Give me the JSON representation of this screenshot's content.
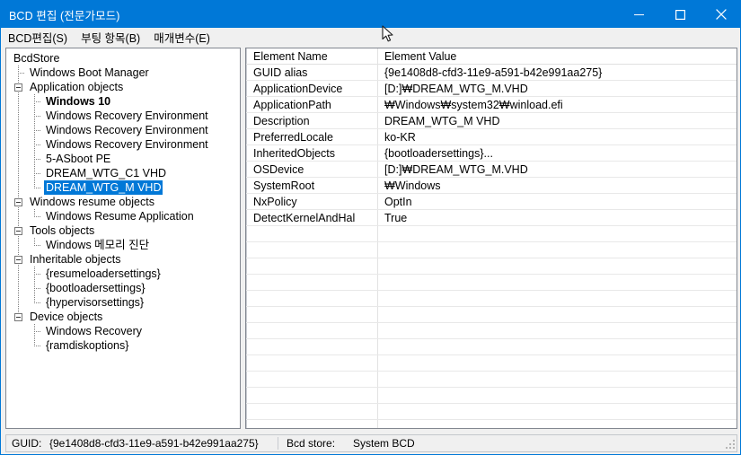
{
  "window": {
    "title": "BCD 편집 (전문가모드)",
    "accent_color": "#0078d7",
    "controls": {
      "minimize": "minimize-icon",
      "maximize": "maximize-icon",
      "close": "close-icon"
    }
  },
  "menubar": {
    "items": [
      {
        "label": "BCD편집(S)"
      },
      {
        "label": "부팅 항목(B)"
      },
      {
        "label": "매개변수(E)"
      }
    ]
  },
  "tree": {
    "nodes": [
      {
        "label": "BcdStore",
        "level": 0,
        "expander": false,
        "bold": false,
        "selected": false
      },
      {
        "label": "Windows Boot Manager",
        "level": 1,
        "expander": false,
        "bold": false,
        "selected": false
      },
      {
        "label": "Application objects",
        "level": 1,
        "expander": true,
        "bold": false,
        "selected": false
      },
      {
        "label": "Windows 10",
        "level": 2,
        "expander": false,
        "bold": true,
        "selected": false
      },
      {
        "label": "Windows Recovery Environment",
        "level": 2,
        "expander": false,
        "bold": false,
        "selected": false
      },
      {
        "label": "Windows Recovery Environment",
        "level": 2,
        "expander": false,
        "bold": false,
        "selected": false
      },
      {
        "label": "Windows Recovery Environment",
        "level": 2,
        "expander": false,
        "bold": false,
        "selected": false
      },
      {
        "label": "5-ASboot PE",
        "level": 2,
        "expander": false,
        "bold": false,
        "selected": false
      },
      {
        "label": "DREAM_WTG_C1 VHD",
        "level": 2,
        "expander": false,
        "bold": false,
        "selected": false
      },
      {
        "label": "DREAM_WTG_M VHD",
        "level": 2,
        "expander": false,
        "bold": false,
        "selected": true
      },
      {
        "label": "Windows resume objects",
        "level": 1,
        "expander": true,
        "bold": false,
        "selected": false
      },
      {
        "label": "Windows Resume Application",
        "level": 2,
        "expander": false,
        "bold": false,
        "selected": false
      },
      {
        "label": "Tools objects",
        "level": 1,
        "expander": true,
        "bold": false,
        "selected": false
      },
      {
        "label": "Windows 메모리 진단",
        "level": 2,
        "expander": false,
        "bold": false,
        "selected": false
      },
      {
        "label": "Inheritable objects",
        "level": 1,
        "expander": true,
        "bold": false,
        "selected": false
      },
      {
        "label": "{resumeloadersettings}",
        "level": 2,
        "expander": false,
        "bold": false,
        "selected": false
      },
      {
        "label": "{bootloadersettings}",
        "level": 2,
        "expander": false,
        "bold": false,
        "selected": false
      },
      {
        "label": "{hypervisorsettings}",
        "level": 2,
        "expander": false,
        "bold": false,
        "selected": false
      },
      {
        "label": "Device objects",
        "level": 1,
        "expander": true,
        "bold": false,
        "selected": false
      },
      {
        "label": "Windows Recovery",
        "level": 2,
        "expander": false,
        "bold": false,
        "selected": false
      },
      {
        "label": "{ramdiskoptions}",
        "level": 2,
        "expander": false,
        "bold": false,
        "selected": false
      }
    ]
  },
  "list": {
    "columns": {
      "name": "Element Name",
      "value": "Element Value"
    },
    "rows": [
      {
        "name": "GUID alias",
        "value": "{9e1408d8-cfd3-11e9-a591-b42e991aa275}"
      },
      {
        "name": "ApplicationDevice",
        "value": "[D:]₩DREAM_WTG_M.VHD"
      },
      {
        "name": "ApplicationPath",
        "value": "₩Windows₩system32₩winload.efi"
      },
      {
        "name": "Description",
        "value": "DREAM_WTG_M VHD"
      },
      {
        "name": "PreferredLocale",
        "value": "ko-KR"
      },
      {
        "name": "InheritedObjects",
        "value": "{bootloadersettings}..."
      },
      {
        "name": "OSDevice",
        "value": "[D:]₩DREAM_WTG_M.VHD"
      },
      {
        "name": "SystemRoot",
        "value": "₩Windows"
      },
      {
        "name": "NxPolicy",
        "value": "OptIn"
      },
      {
        "name": "DetectKernelAndHal",
        "value": "True"
      }
    ],
    "empty_row_count": 13
  },
  "statusbar": {
    "guid_label": "GUID:",
    "guid_value": "{9e1408d8-cfd3-11e9-a591-b42e991aa275}",
    "store_label": "Bcd store:",
    "store_value": "System BCD"
  }
}
